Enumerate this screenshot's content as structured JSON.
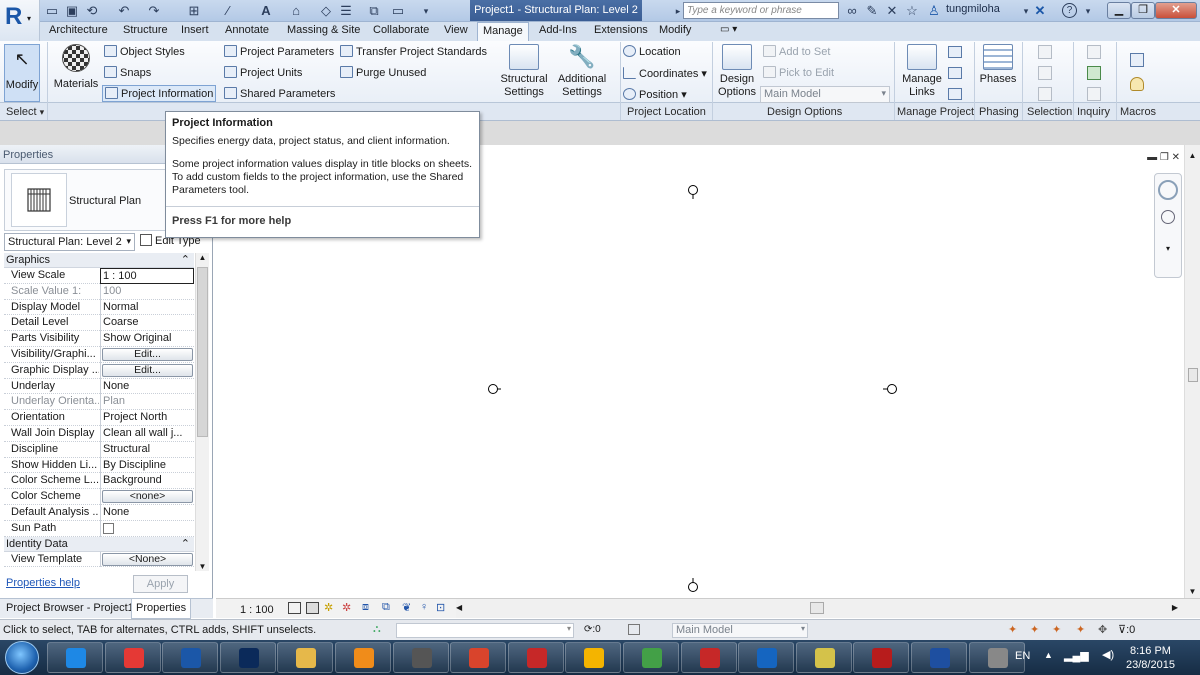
{
  "window": {
    "title": "Project1 - Structural Plan: Level 2",
    "search_placeholder": "Type a keyword or phrase",
    "user": "tungmiloha"
  },
  "tabs": [
    "Architecture",
    "Structure",
    "Insert",
    "Annotate",
    "Massing & Site",
    "Collaborate",
    "View",
    "Manage",
    "Add-Ins",
    "Extensions",
    "Modify"
  ],
  "active_tab": "Manage",
  "ribbon": {
    "modify": "Modify",
    "materials": "Materials",
    "object_styles": "Object Styles",
    "snaps": "Snaps",
    "project_information": "Project Information",
    "project_parameters": "Project Parameters",
    "project_units": "Project Units",
    "shared_parameters": "Shared Parameters",
    "transfer_standards": "Transfer Project Standards",
    "purge_unused": "Purge Unused",
    "structural_settings": [
      "Structural",
      "Settings"
    ],
    "additional_settings": [
      "Additional",
      "Settings"
    ],
    "location": "Location",
    "coordinates": "Coordinates",
    "position": "Position",
    "design_options": [
      "Design",
      "Options"
    ],
    "add_to_set": "Add to Set",
    "pick_to_edit": "Pick to Edit",
    "main_model": "Main Model",
    "manage_links": [
      "Manage",
      "Links"
    ],
    "phases": "Phases",
    "panel_labels": [
      "Select",
      "Project Location",
      "Design Options",
      "Manage Project",
      "Phasing",
      "Selection",
      "Inquiry",
      "Macros"
    ]
  },
  "tooltip": {
    "title": "Project Information",
    "desc": "Specifies energy data, project status, and client information.",
    "more": "Some project information values display in title blocks on sheets. To add custom fields to the project information, use the Shared Parameters tool.",
    "help": "Press F1 for more help"
  },
  "properties": {
    "header": "Properties",
    "type_name": "Structural Plan",
    "selector": "Structural Plan: Level 2",
    "edit_type": "Edit Type",
    "groups": [
      {
        "name": "Graphics",
        "rows": [
          {
            "k": "View Scale",
            "v": "1 : 100",
            "kind": "sel"
          },
          {
            "k": "Scale Value    1:",
            "v": "100",
            "kind": "ro"
          },
          {
            "k": "Display Model",
            "v": "Normal"
          },
          {
            "k": "Detail Level",
            "v": "Coarse"
          },
          {
            "k": "Parts Visibility",
            "v": "Show Original"
          },
          {
            "k": "Visibility/Graphi...",
            "v": "Edit...",
            "kind": "btn"
          },
          {
            "k": "Graphic Display ...",
            "v": "Edit...",
            "kind": "btn"
          },
          {
            "k": "Underlay",
            "v": "None"
          },
          {
            "k": "Underlay Orienta...",
            "v": "Plan",
            "kind": "ro"
          },
          {
            "k": "Orientation",
            "v": "Project North"
          },
          {
            "k": "Wall Join Display",
            "v": "Clean all wall j..."
          },
          {
            "k": "Discipline",
            "v": "Structural"
          },
          {
            "k": "Show Hidden Li...",
            "v": "By Discipline"
          },
          {
            "k": "Color Scheme L...",
            "v": "Background"
          },
          {
            "k": "Color Scheme",
            "v": "<none>",
            "kind": "btn"
          },
          {
            "k": "Default Analysis ...",
            "v": "None"
          },
          {
            "k": "Sun Path",
            "v": "",
            "kind": "check"
          }
        ]
      },
      {
        "name": "Identity Data",
        "rows": [
          {
            "k": "View Template",
            "v": "<None>",
            "kind": "btn"
          }
        ]
      }
    ],
    "help": "Properties help",
    "apply": "Apply"
  },
  "bottom_tabs": [
    "Project Browser - Project1",
    "Properties"
  ],
  "view_scale": "1 : 100",
  "status": {
    "text": "Click to select, TAB for alternates, CTRL adds, SHIFT unselects.",
    "count": ":0",
    "model": "Main Model",
    "filter": ":0"
  },
  "taskbar": {
    "lang": "EN",
    "time": "8:16 PM",
    "date": "23/8/2015",
    "apps": [
      "ie",
      "office",
      "revit",
      "photoshop",
      "explorer",
      "media-player",
      "cad",
      "autocad",
      "unknown",
      "chrome",
      "evernote",
      "acrobat",
      "maps",
      "folder",
      "pdf",
      "word",
      "tool"
    ]
  },
  "colors": {
    "accent": "#1b57a8",
    "title_bar": "#3a5d94",
    "taskbar": "#1e3652"
  }
}
